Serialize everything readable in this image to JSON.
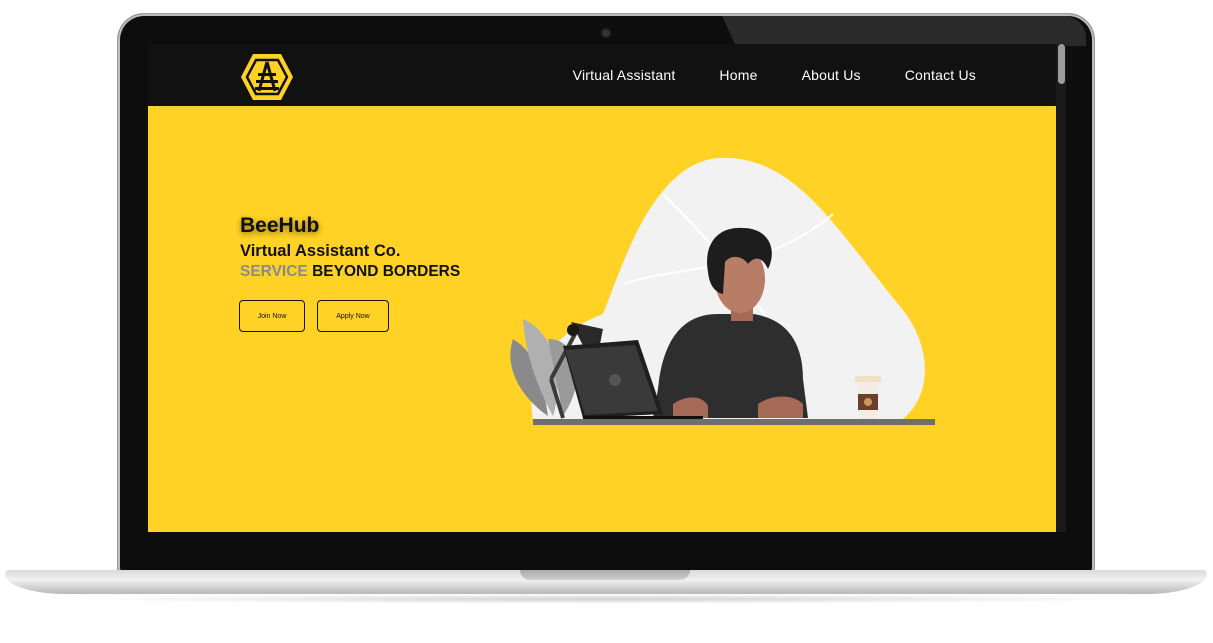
{
  "site": {
    "nav": {
      "links": [
        "Virtual Assistant",
        "Home",
        "About Us",
        "Contact Us"
      ]
    },
    "hero": {
      "title": "BeeHub",
      "subtitle": "Virtual Assistant Co.",
      "tagline_muted": "SERVICE",
      "tagline_rest": " BEYOND BORDERS",
      "join_label": "Join Now",
      "apply_label": "Apply Now"
    }
  },
  "colors": {
    "accent": "#ffd225",
    "navbar": "#111111",
    "text": "#111111",
    "muted": "#8a8a8a"
  },
  "icons": {
    "logo": "hexagon-bee-ladder-logo"
  }
}
